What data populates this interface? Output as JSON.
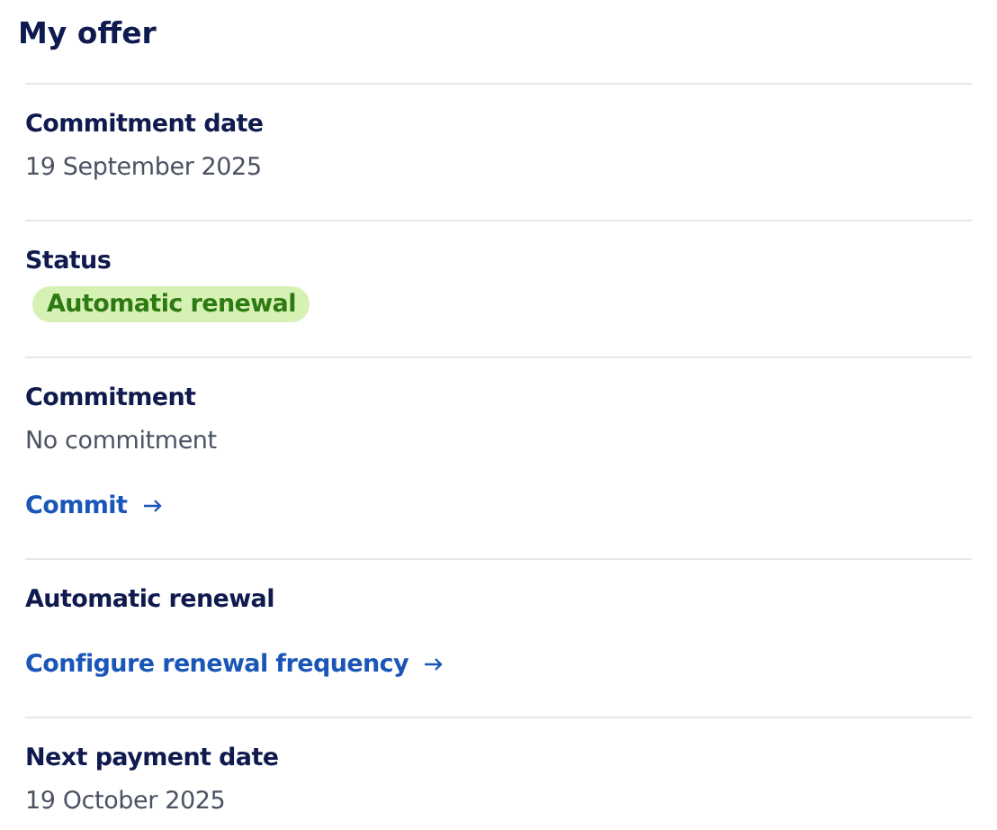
{
  "title": "My offer",
  "sections": [
    {
      "label": "Commitment date",
      "items": [
        {
          "kind": "value",
          "text": "19 September 2025"
        }
      ]
    },
    {
      "label": "Status",
      "items": [
        {
          "kind": "badge",
          "text": "Automatic renewal"
        }
      ]
    },
    {
      "label": "Commitment",
      "items": [
        {
          "kind": "value",
          "text": "No commitment"
        },
        {
          "kind": "link",
          "text": "Commit"
        }
      ]
    },
    {
      "label": "Automatic renewal",
      "items": [
        {
          "kind": "link",
          "text": "Configure renewal frequency"
        }
      ]
    },
    {
      "label": "Next payment date",
      "items": [
        {
          "kind": "value",
          "text": "19 October 2025"
        }
      ]
    }
  ]
}
